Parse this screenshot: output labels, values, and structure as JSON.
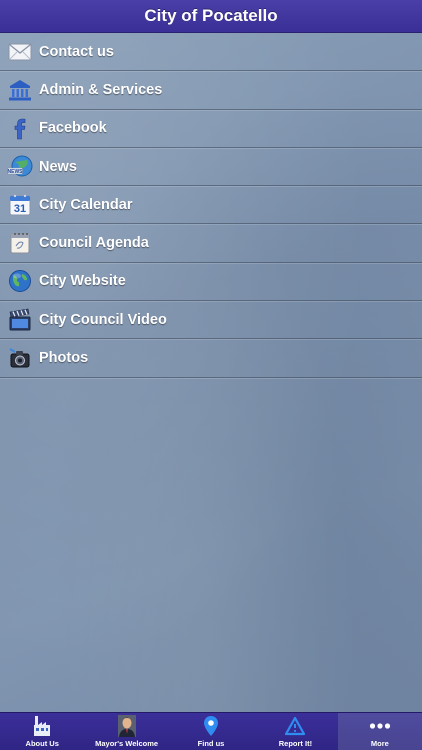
{
  "header": {
    "title": "City of Pocatello"
  },
  "menu": {
    "items": [
      {
        "label": "Contact us",
        "icon": "mail-icon"
      },
      {
        "label": "Admin & Services",
        "icon": "government-building-icon"
      },
      {
        "label": "Facebook",
        "icon": "facebook-icon"
      },
      {
        "label": "News",
        "icon": "news-globe-icon"
      },
      {
        "label": "City Calendar",
        "icon": "calendar-icon",
        "calendar_day": "31"
      },
      {
        "label": "Council Agenda",
        "icon": "agenda-icon"
      },
      {
        "label": "City Website",
        "icon": "globe-icon"
      },
      {
        "label": "City Council Video",
        "icon": "video-clapperboard-icon"
      },
      {
        "label": "Photos",
        "icon": "camera-icon"
      }
    ]
  },
  "tabbar": {
    "tabs": [
      {
        "label": "About Us",
        "icon": "factory-icon",
        "active": false
      },
      {
        "label": "Mayor's Welcome",
        "icon": "mayor-portrait-icon",
        "active": false
      },
      {
        "label": "Find us",
        "icon": "map-pin-icon",
        "active": false
      },
      {
        "label": "Report It!",
        "icon": "warning-triangle-icon",
        "active": false
      },
      {
        "label": "More",
        "icon": "more-dots-icon",
        "active": true
      }
    ]
  },
  "colors": {
    "header_bg": "#3a2f96",
    "tabbar_bg": "#2f2585",
    "background": "#7f93ad",
    "text": "#ffffff"
  }
}
